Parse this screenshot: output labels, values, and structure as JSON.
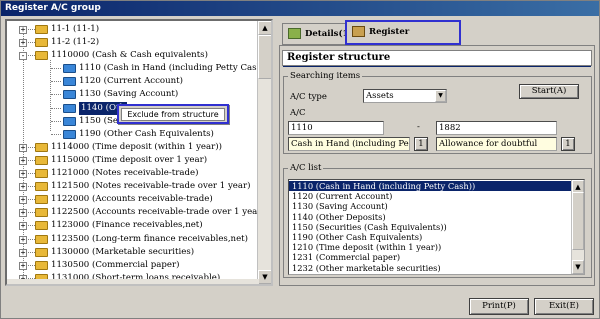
{
  "window": {
    "title": "Register A/C group"
  },
  "tree": {
    "rows": [
      {
        "label": "11-1 (11-1)",
        "folder": "yellow",
        "indent": 0,
        "expander": "+"
      },
      {
        "label": "11-2 (11-2)",
        "folder": "yellow",
        "indent": 0,
        "expander": "+"
      },
      {
        "label": "1110000 (Cash & Cash equivalents)",
        "folder": "yellow",
        "indent": 0,
        "expander": "-"
      },
      {
        "label": "1110 (Cash in Hand (including Petty Cash))",
        "folder": "blue",
        "indent": 1,
        "expander": ""
      },
      {
        "label": "1120 (Current Account)",
        "folder": "blue",
        "indent": 1,
        "expander": ""
      },
      {
        "label": "1130 (Saving Account)",
        "folder": "blue",
        "indent": 1,
        "expander": ""
      },
      {
        "label": "1140 (Oth",
        "folder": "blue",
        "indent": 1,
        "expander": "",
        "selected": true
      },
      {
        "label": "1150 (Sec",
        "folder": "blue",
        "indent": 1,
        "expander": ""
      },
      {
        "label": "1190 (Other Cash Equivalents)",
        "folder": "blue",
        "indent": 1,
        "expander": ""
      },
      {
        "label": "1114000 (Time deposit (within 1 year))",
        "folder": "yellow",
        "indent": 0,
        "expander": "+"
      },
      {
        "label": "1115000 (Time deposit over 1 year)",
        "folder": "yellow",
        "indent": 0,
        "expander": "+"
      },
      {
        "label": "1121000 (Notes receivable-trade)",
        "folder": "yellow",
        "indent": 0,
        "expander": "+"
      },
      {
        "label": "1121500 (Notes receivable-trade over 1 year)",
        "folder": "yellow",
        "indent": 0,
        "expander": "+"
      },
      {
        "label": "1122000 (Accounts receivable-trade)",
        "folder": "yellow",
        "indent": 0,
        "expander": "+"
      },
      {
        "label": "1122500 (Accounts receivable-trade over 1 year)",
        "folder": "yellow",
        "indent": 0,
        "expander": "+"
      },
      {
        "label": "1123000 (Finance receivables,net)",
        "folder": "yellow",
        "indent": 0,
        "expander": "+"
      },
      {
        "label": "1123500 (Long-term finance receivables,net)",
        "folder": "yellow",
        "indent": 0,
        "expander": "+"
      },
      {
        "label": "1130000 (Marketable securities)",
        "folder": "yellow",
        "indent": 0,
        "expander": "+"
      },
      {
        "label": "1130500 (Commercial paper)",
        "folder": "yellow",
        "indent": 0,
        "expander": "+"
      },
      {
        "label": "1131000 (Short-term loans receivable)",
        "folder": "yellow",
        "indent": 0,
        "expander": "+"
      }
    ]
  },
  "context_menu": {
    "item": "Exclude from structure"
  },
  "tabs": [
    {
      "label": "Details(1)",
      "active": false
    },
    {
      "label": "Register structure(2)",
      "active": true
    }
  ],
  "panel": {
    "title": "Register structure",
    "search_group": "Searching items",
    "ac_type_label": "A/C type",
    "ac_type_value": "Assets",
    "start_button": "Start(A)",
    "ac_label": "A/C",
    "ac_from": "1110",
    "range_separator": "-",
    "ac_to": "1882",
    "ac_from_name": "Cash in Hand (including Petty",
    "ac_to_name": "Allowance for doubtful",
    "lookup_button": "1",
    "list_title": "A/C list",
    "list_items": [
      "1110  (Cash in Hand (including Petty Cash))",
      "1120  (Current Account)",
      "1130  (Saving Account)",
      "1140  (Other Deposits)",
      "1150  (Securities (Cash Equivalents))",
      "1190  (Other Cash Equivalents)",
      "1210  (Time deposit (within 1 year))",
      "1231  (Commercial paper)",
      "1232  (Other marketable securities)"
    ]
  },
  "footer": {
    "print_button": "Print(P)",
    "exit_button": "Exit(E)"
  }
}
